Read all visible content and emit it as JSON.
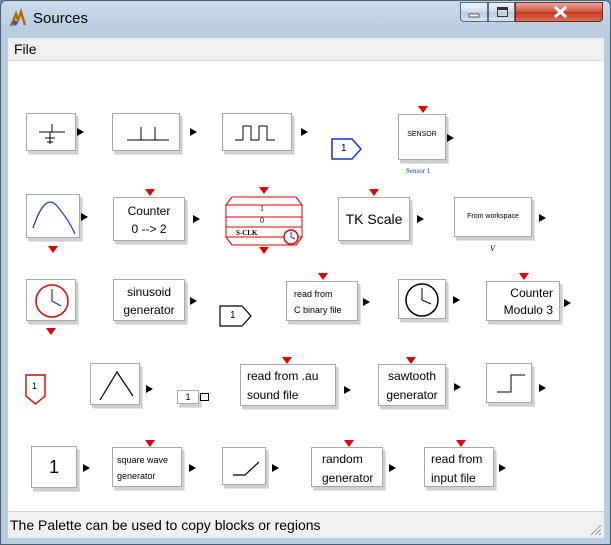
{
  "window": {
    "title": "Sources"
  },
  "menu": {
    "file": "File"
  },
  "status": {
    "text": "The Palette can be used to copy blocks or regions"
  },
  "blocks": {
    "counter": {
      "line1": "Counter",
      "line2": "0 --> 2"
    },
    "sensor": {
      "label": "SENSOR",
      "caption": "Sensor 1"
    },
    "sclk": {
      "top": "1",
      "mid": "0",
      "label": "S-CLK"
    },
    "tkscale": {
      "label": "TK Scale"
    },
    "fromws": {
      "label": "From workspace",
      "caption": "V"
    },
    "sinusoid": {
      "line1": "sinusoid",
      "line2": "generator"
    },
    "readc": {
      "line1": "read from",
      "line2": "C binary file"
    },
    "modulo": {
      "line1": "Counter",
      "line2": "Modulo 3"
    },
    "inport_blue": {
      "label": "1"
    },
    "inport_black": {
      "label": "1"
    },
    "inport_red": {
      "label": "1"
    },
    "small_const": {
      "label": "1"
    },
    "readau": {
      "line1": "read from .au",
      "line2": "sound file"
    },
    "sawtooth": {
      "line1": "sawtooth",
      "line2": "generator"
    },
    "const1": {
      "label": "1"
    },
    "square": {
      "line1": "square wave",
      "line2": "generator"
    },
    "random": {
      "line1": "random",
      "line2": "generator"
    },
    "readinput": {
      "line1": "read from",
      "line2": "input file"
    }
  }
}
